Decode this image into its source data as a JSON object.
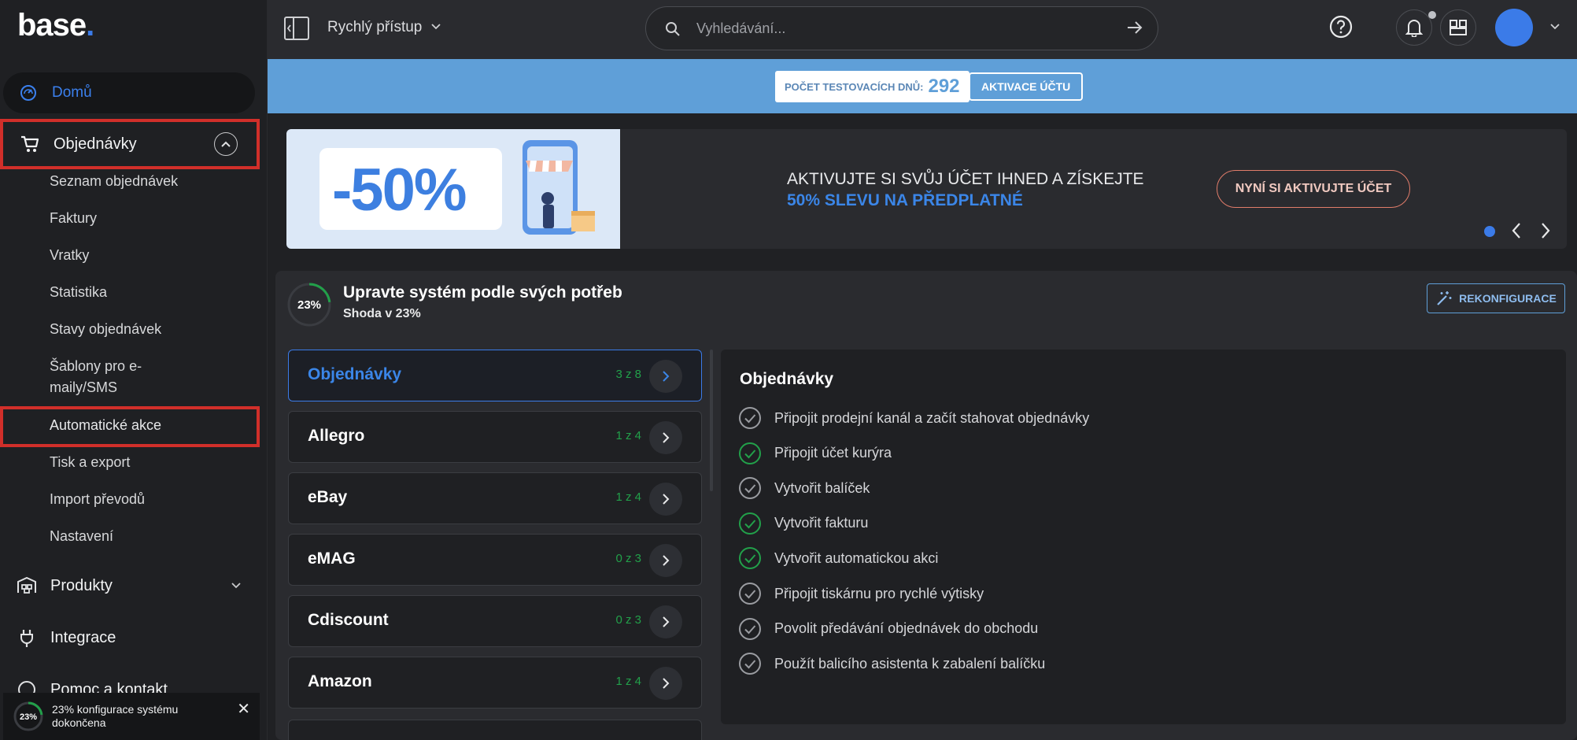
{
  "sidebar": {
    "logo": "base",
    "home_label": "Domů",
    "orders_label": "Objednávky",
    "orders_sub": [
      "Seznam objednávek",
      "Faktury",
      "Vratky",
      "Statistika",
      "Stavy objednávek",
      "Šablony pro e-\nmaily/SMS",
      "Automatické akce",
      "Tisk a export",
      "Import převodů",
      "Nastavení"
    ],
    "products_label": "Produkty",
    "integration_label": "Integrace",
    "help_contact_label": "Pomoc a kontakt",
    "toast": {
      "percent": "23%",
      "text": "23% konfigurace systému dokončena"
    }
  },
  "topbar": {
    "quick_access": "Rychlý přístup",
    "search_placeholder": "Vyhledávání..."
  },
  "trial": {
    "label": "POČET TESTOVACÍCH DNŮ:",
    "days": "292",
    "activate": "AKTIVACE ÚČTU"
  },
  "banner": {
    "discount": "-50%",
    "line1": "AKTIVUJTE SI SVŮJ ÚČET IHNED A ZÍSKEJTE",
    "line2": "50% SLEVU NA PŘEDPLATNÉ",
    "cta": "NYNÍ SI AKTIVUJTE ÚČET"
  },
  "config": {
    "percent": "23%",
    "progress": 0.23,
    "title": "Upravte systém podle svých potřeb",
    "subtitle": "Shoda v 23%",
    "reconfigure": "REKONFIGURACE",
    "categories": [
      {
        "name": "Objednávky",
        "count": "3 z 8",
        "active": true
      },
      {
        "name": "Allegro",
        "count": "1 z 4",
        "active": false
      },
      {
        "name": "eBay",
        "count": "1 z 4",
        "active": false
      },
      {
        "name": "eMAG",
        "count": "0 z 3",
        "active": false
      },
      {
        "name": "Cdiscount",
        "count": "0 z 3",
        "active": false
      },
      {
        "name": "Amazon",
        "count": "1 z 4",
        "active": false
      }
    ],
    "detail_title": "Objednávky",
    "tasks": [
      {
        "label": "Připojit prodejní kanál a začít stahovat objednávky",
        "done": false
      },
      {
        "label": "Připojit účet kurýra",
        "done": true
      },
      {
        "label": "Vytvořit balíček",
        "done": false
      },
      {
        "label": "Vytvořit fakturu",
        "done": true
      },
      {
        "label": "Vytvořit automatickou akci",
        "done": true
      },
      {
        "label": "Připojit tiskárnu pro rychlé výtisky",
        "done": false
      },
      {
        "label": "Povolit předávání objednávek do obchodu",
        "done": false
      },
      {
        "label": "Použít balicího asistenta k zabalení balíčku",
        "done": false
      }
    ]
  },
  "colors": {
    "accent": "#3b7be8",
    "success": "#22a04a",
    "highlight": "#d12f2a",
    "trial_bar": "#5f9fd8"
  }
}
